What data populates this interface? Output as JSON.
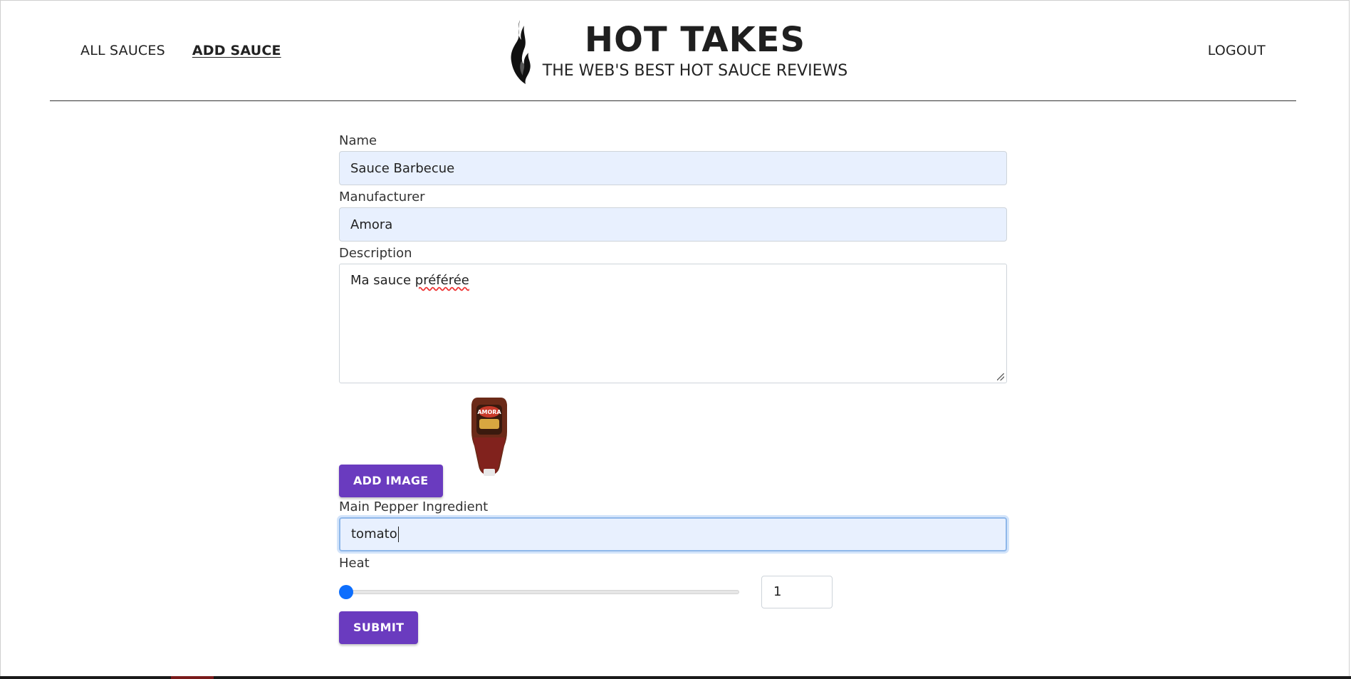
{
  "nav": {
    "all_sauces": "ALL SAUCES",
    "add_sauce": "ADD SAUCE",
    "logout": "LOGOUT"
  },
  "brand": {
    "title": "HOT TAKES",
    "subtitle": "THE WEB'S BEST HOT SAUCE REVIEWS",
    "logo_icon": "flame-icon"
  },
  "form": {
    "name": {
      "label": "Name",
      "value": "Sauce Barbecue"
    },
    "manufacturer": {
      "label": "Manufacturer",
      "value": "Amora"
    },
    "description": {
      "label": "Description",
      "value_prefix": "Ma sauce ",
      "value_spellcheck": "préférée"
    },
    "add_image_label": "ADD IMAGE",
    "image_preview": "sauce-bottle-image",
    "main_pepper": {
      "label": "Main Pepper Ingredient",
      "value": "tomato"
    },
    "heat": {
      "label": "Heat",
      "value": "1",
      "slider_fraction": 0
    },
    "submit_label": "SUBMIT"
  },
  "colors": {
    "button": "#6a3bbf",
    "input_fill": "#e8f0fe",
    "slider_thumb": "#0d6efd",
    "focus_ring": "#8fb8ea"
  }
}
